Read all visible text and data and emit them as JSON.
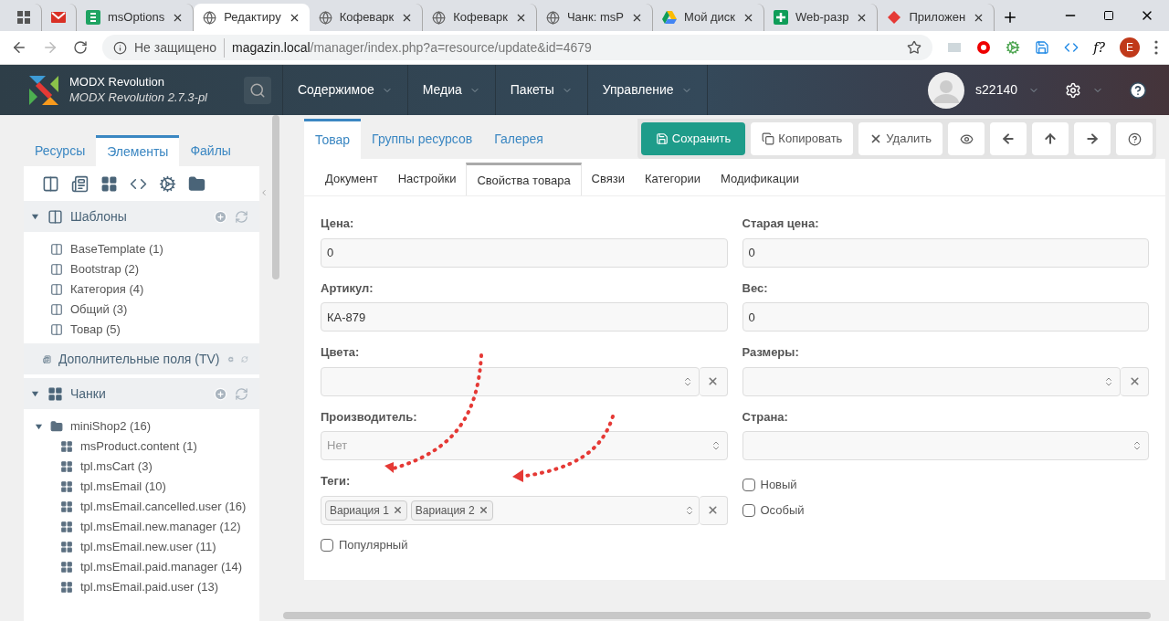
{
  "browser": {
    "tabs": [
      {
        "selected": false
      },
      {
        "selected": false
      },
      {
        "label": "msOptions",
        "selected": false
      },
      {
        "label": "Редактиру",
        "selected": true
      },
      {
        "label": "Кофеварк",
        "selected": false
      },
      {
        "label": "Кофеварк",
        "selected": false
      },
      {
        "label": "Чанк: msP",
        "selected": false
      },
      {
        "label": "Мой диск",
        "selected": false
      },
      {
        "label": "Web-разр",
        "selected": false
      },
      {
        "label": "Приложен",
        "selected": false
      }
    ],
    "security": "Не защищено",
    "url_host": "magazin.local",
    "url_path": "/manager/index.php?a=resource/update&id=4679",
    "ext_text": "f?",
    "profile": "E"
  },
  "header": {
    "brand": "MODX Revolution",
    "version": "MODX Revolution 2.7.3-pl",
    "menu": [
      "Содержимое",
      "Медиа",
      "Пакеты",
      "Управление"
    ],
    "user": "s22140"
  },
  "sidebar": {
    "tabs": [
      {
        "label": "Ресурсы",
        "selected": false
      },
      {
        "label": "Элементы",
        "selected": true
      },
      {
        "label": "Файлы",
        "selected": false
      }
    ],
    "sections": [
      {
        "title": "Шаблоны",
        "kind": "template",
        "expanded": true,
        "items": [
          {
            "label": "BaseTemplate (1)",
            "kind": "template"
          },
          {
            "label": "Bootstrap (2)",
            "kind": "template"
          },
          {
            "label": "Категория (4)",
            "kind": "template"
          },
          {
            "label": "Общий (3)",
            "kind": "template"
          },
          {
            "label": "Товар (5)",
            "kind": "template"
          }
        ]
      },
      {
        "title": "Дополнительные поля (TV)",
        "kind": "tv",
        "expanded": false
      },
      {
        "title": "Чанки",
        "kind": "chunk",
        "expanded": true,
        "items": [
          {
            "label": "miniShop2 (16)",
            "kind": "folder",
            "expanded": true,
            "children": [
              {
                "label": "msProduct.content (1)",
                "kind": "chunk"
              },
              {
                "label": "tpl.msCart (3)",
                "kind": "chunk"
              },
              {
                "label": "tpl.msEmail (10)",
                "kind": "chunk"
              },
              {
                "label": "tpl.msEmail.cancelled.user (16)",
                "kind": "chunk"
              },
              {
                "label": "tpl.msEmail.new.manager (12)",
                "kind": "chunk"
              },
              {
                "label": "tpl.msEmail.new.user (11)",
                "kind": "chunk"
              },
              {
                "label": "tpl.msEmail.paid.manager (14)",
                "kind": "chunk"
              },
              {
                "label": "tpl.msEmail.paid.user (13)",
                "kind": "chunk"
              }
            ]
          }
        ]
      }
    ]
  },
  "main": {
    "tabs": [
      {
        "label": "Товар",
        "selected": true
      },
      {
        "label": "Группы ресурсов",
        "selected": false
      },
      {
        "label": "Галерея",
        "selected": false
      }
    ],
    "buttons": [
      {
        "label": "Сохранить",
        "kind": "save"
      },
      {
        "label": "Копировать",
        "kind": "copy"
      },
      {
        "label": "Удалить",
        "kind": "delete"
      },
      {
        "kind": "view"
      },
      {
        "kind": "prev"
      },
      {
        "kind": "up"
      },
      {
        "kind": "next"
      },
      {
        "kind": "help"
      }
    ],
    "subtabs": [
      {
        "label": "Документ",
        "selected": false
      },
      {
        "label": "Настройки",
        "selected": false
      },
      {
        "label": "Свойства товара",
        "selected": true
      },
      {
        "label": "Связи",
        "selected": false
      },
      {
        "label": "Категории",
        "selected": false
      },
      {
        "label": "Модификации",
        "selected": false
      }
    ],
    "columns": [
      [
        {
          "kind": "text",
          "label": "Цена:",
          "value": "0"
        },
        {
          "kind": "text",
          "label": "Артикул:",
          "value": "КА-879"
        },
        {
          "kind": "combo",
          "label": "Цвета:"
        },
        {
          "kind": "select",
          "label": "Производитель:",
          "placeholder": "Нет"
        },
        {
          "kind": "tags",
          "label": "Теги:",
          "tags": [
            "Вариация 1",
            "Вариация 2"
          ]
        },
        {
          "kind": "checkbox",
          "label": "Популярный",
          "checked": false
        }
      ],
      [
        {
          "kind": "text",
          "label": "Старая цена:",
          "value": "0"
        },
        {
          "kind": "text",
          "label": "Вес:",
          "value": "0"
        },
        {
          "kind": "combo",
          "label": "Размеры:"
        },
        {
          "kind": "select",
          "label": "Страна:"
        },
        {
          "kind": "checkbox",
          "label": "Новый",
          "checked": false
        },
        {
          "kind": "checkbox",
          "label": "Особый",
          "checked": false
        }
      ]
    ]
  }
}
